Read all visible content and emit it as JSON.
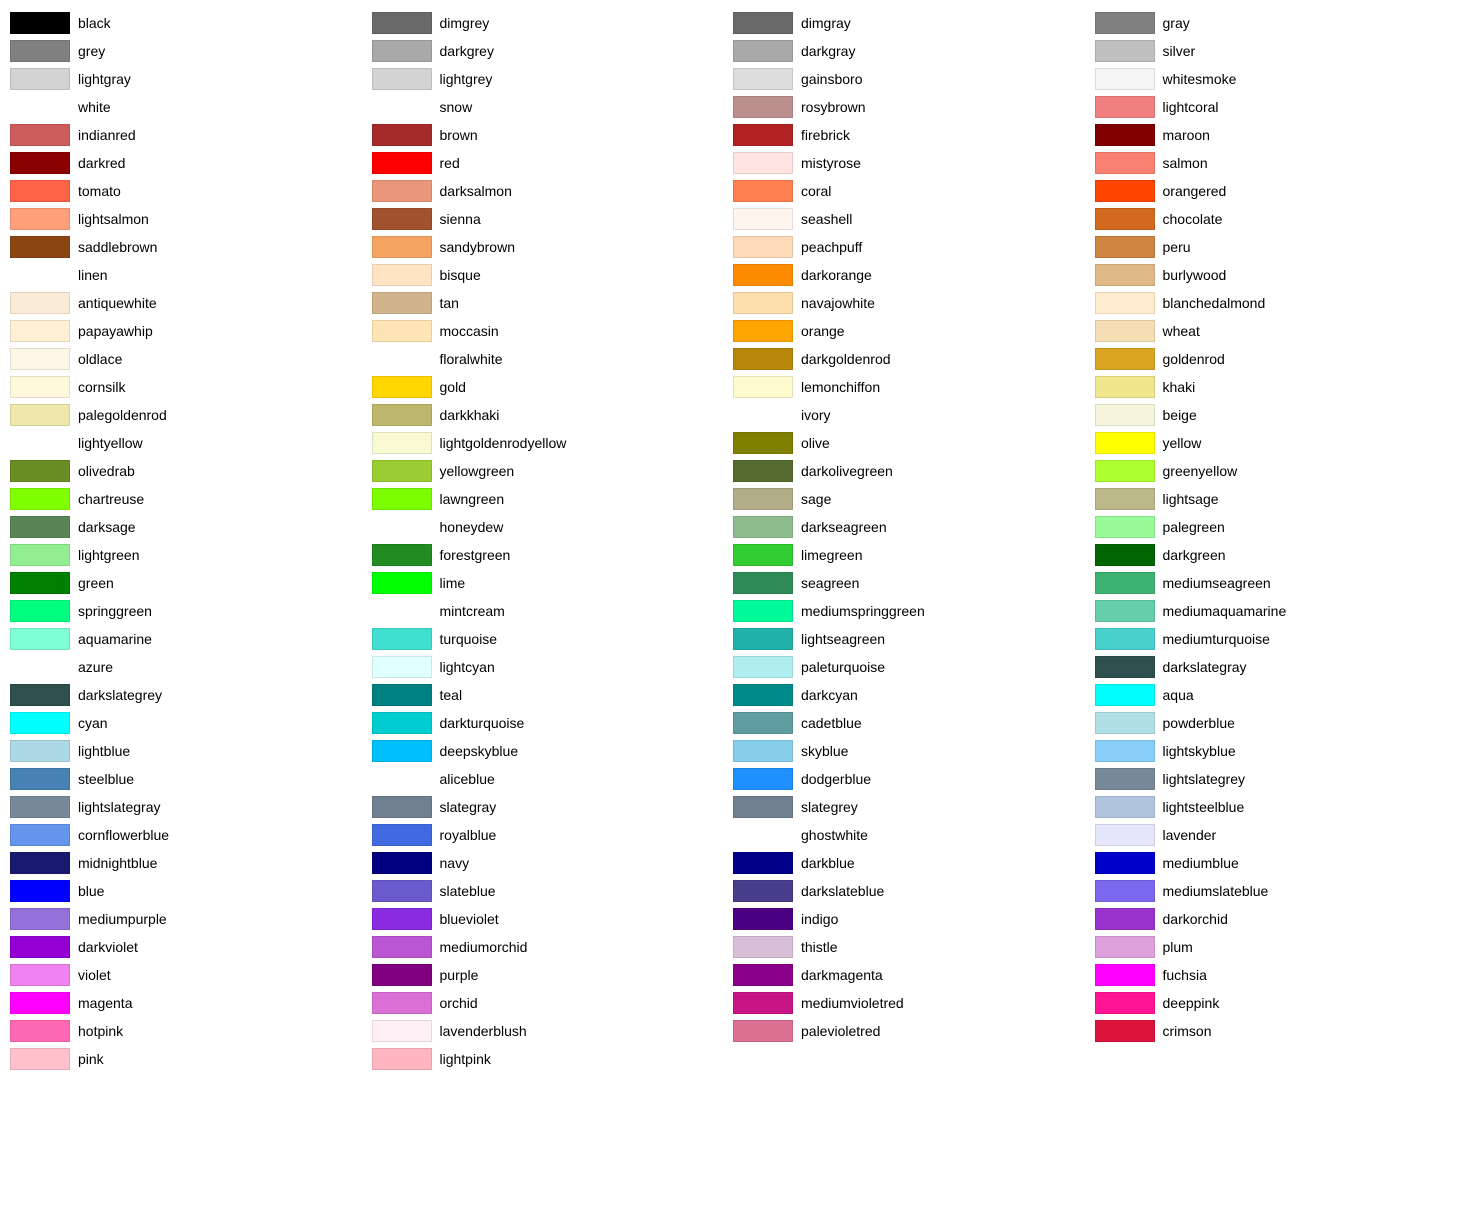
{
  "columns": [
    [
      {
        "name": "black",
        "color": "#000000"
      },
      {
        "name": "grey",
        "color": "#808080"
      },
      {
        "name": "lightgray",
        "color": "#d3d3d3"
      },
      {
        "name": "white",
        "color": null
      },
      {
        "name": "indianred",
        "color": "#cd5c5c"
      },
      {
        "name": "darkred",
        "color": "#8b0000"
      },
      {
        "name": "tomato",
        "color": "#ff6347"
      },
      {
        "name": "lightsalmon",
        "color": "#ffa07a"
      },
      {
        "name": "saddlebrown",
        "color": "#8b4513"
      },
      {
        "name": "linen",
        "color": null
      },
      {
        "name": "antiquewhite",
        "color": "#faebd7"
      },
      {
        "name": "papayawhip",
        "color": "#ffefd5"
      },
      {
        "name": "oldlace",
        "color": "#fdf5e6"
      },
      {
        "name": "cornsilk",
        "color": "#fff8dc"
      },
      {
        "name": "palegoldenrod",
        "color": "#eee8aa"
      },
      {
        "name": "lightyellow",
        "color": null
      },
      {
        "name": "olivedrab",
        "color": "#6b8e23"
      },
      {
        "name": "chartreuse",
        "color": "#7fff00"
      },
      {
        "name": "darksage",
        "color": "#598556"
      },
      {
        "name": "lightgreen",
        "color": "#90ee90"
      },
      {
        "name": "green",
        "color": "#008000"
      },
      {
        "name": "springgreen",
        "color": "#00ff7f"
      },
      {
        "name": "aquamarine",
        "color": "#7fffd4"
      },
      {
        "name": "azure",
        "color": null
      },
      {
        "name": "darkslategrey",
        "color": "#2f4f4f"
      },
      {
        "name": "cyan",
        "color": "#00ffff"
      },
      {
        "name": "lightblue",
        "color": "#add8e6"
      },
      {
        "name": "steelblue",
        "color": "#4682b4"
      },
      {
        "name": "lightslategray",
        "color": "#778899"
      },
      {
        "name": "cornflowerblue",
        "color": "#6495ed"
      },
      {
        "name": "midnightblue",
        "color": "#191970"
      },
      {
        "name": "blue",
        "color": "#0000ff"
      },
      {
        "name": "mediumpurple",
        "color": "#9370db"
      },
      {
        "name": "darkviolet",
        "color": "#9400d3"
      },
      {
        "name": "violet",
        "color": "#ee82ee"
      },
      {
        "name": "magenta",
        "color": "#ff00ff"
      },
      {
        "name": "hotpink",
        "color": "#ff69b4"
      },
      {
        "name": "pink",
        "color": "#ffc0cb"
      }
    ],
    [
      {
        "name": "dimgrey",
        "color": "#696969"
      },
      {
        "name": "darkgrey",
        "color": "#a9a9a9"
      },
      {
        "name": "lightgrey",
        "color": "#d3d3d3"
      },
      {
        "name": "snow",
        "color": null
      },
      {
        "name": "brown",
        "color": "#a52a2a"
      },
      {
        "name": "red",
        "color": "#ff0000"
      },
      {
        "name": "darksalmon",
        "color": "#e9967a"
      },
      {
        "name": "sienna",
        "color": "#a0522d"
      },
      {
        "name": "sandybrown",
        "color": "#f4a460"
      },
      {
        "name": "bisque",
        "color": "#ffe4c4"
      },
      {
        "name": "tan",
        "color": "#d2b48c"
      },
      {
        "name": "moccasin",
        "color": "#ffe4b5"
      },
      {
        "name": "floralwhite",
        "color": null
      },
      {
        "name": "gold",
        "color": "#ffd700"
      },
      {
        "name": "darkkhaki",
        "color": "#bdb76b"
      },
      {
        "name": "lightgoldenrodyellow",
        "color": "#fafad2"
      },
      {
        "name": "yellowgreen",
        "color": "#9acd32"
      },
      {
        "name": "lawngreen",
        "color": "#7cfc00"
      },
      {
        "name": "honeydew",
        "color": null
      },
      {
        "name": "forestgreen",
        "color": "#228b22"
      },
      {
        "name": "lime",
        "color": "#00ff00"
      },
      {
        "name": "mintcream",
        "color": null
      },
      {
        "name": "turquoise",
        "color": "#40e0d0"
      },
      {
        "name": "lightcyan",
        "color": "#e0ffff"
      },
      {
        "name": "teal",
        "color": "#008080"
      },
      {
        "name": "darkturquoise",
        "color": "#00ced1"
      },
      {
        "name": "deepskyblue",
        "color": "#00bfff"
      },
      {
        "name": "aliceblue",
        "color": null
      },
      {
        "name": "slategray",
        "color": "#708090"
      },
      {
        "name": "royalblue",
        "color": "#4169e1"
      },
      {
        "name": "navy",
        "color": "#000080"
      },
      {
        "name": "slateblue",
        "color": "#6a5acd"
      },
      {
        "name": "blueviolet",
        "color": "#8a2be2"
      },
      {
        "name": "mediumorchid",
        "color": "#ba55d3"
      },
      {
        "name": "purple",
        "color": "#800080"
      },
      {
        "name": "orchid",
        "color": "#da70d6"
      },
      {
        "name": "lavenderblush",
        "color": "#fff0f5"
      },
      {
        "name": "lightpink",
        "color": "#ffb6c1"
      }
    ],
    [
      {
        "name": "dimgray",
        "color": "#696969"
      },
      {
        "name": "darkgray",
        "color": "#a9a9a9"
      },
      {
        "name": "gainsboro",
        "color": "#dcdcdc"
      },
      {
        "name": "rosybrown",
        "color": "#bc8f8f"
      },
      {
        "name": "firebrick",
        "color": "#b22222"
      },
      {
        "name": "mistyrose",
        "color": "#ffe4e1"
      },
      {
        "name": "coral",
        "color": "#ff7f50"
      },
      {
        "name": "seashell",
        "color": "#fff5ee"
      },
      {
        "name": "peachpuff",
        "color": "#ffdab9"
      },
      {
        "name": "darkorange",
        "color": "#ff8c00"
      },
      {
        "name": "navajowhite",
        "color": "#ffdead"
      },
      {
        "name": "orange",
        "color": "#ffa500"
      },
      {
        "name": "darkgoldenrod",
        "color": "#b8860b"
      },
      {
        "name": "lemonchiffon",
        "color": "#fffacd"
      },
      {
        "name": "ivory",
        "color": null
      },
      {
        "name": "olive",
        "color": "#808000"
      },
      {
        "name": "darkolivegreen",
        "color": "#556b2f"
      },
      {
        "name": "sage",
        "color": "#b2ac88"
      },
      {
        "name": "darkseagreen",
        "color": "#8fbc8f"
      },
      {
        "name": "limegreen",
        "color": "#32cd32"
      },
      {
        "name": "seagreen",
        "color": "#2e8b57"
      },
      {
        "name": "mediumspringgreen",
        "color": "#00fa9a"
      },
      {
        "name": "lightseagreen",
        "color": "#20b2aa"
      },
      {
        "name": "paleturquoise",
        "color": "#afeeee"
      },
      {
        "name": "darkcyan",
        "color": "#008b8b"
      },
      {
        "name": "cadetblue",
        "color": "#5f9ea0"
      },
      {
        "name": "skyblue",
        "color": "#87ceeb"
      },
      {
        "name": "dodgerblue",
        "color": "#1e90ff"
      },
      {
        "name": "slategrey",
        "color": "#708090"
      },
      {
        "name": "ghostwhite",
        "color": null
      },
      {
        "name": "darkblue",
        "color": "#00008b"
      },
      {
        "name": "darkslateblue",
        "color": "#483d8b"
      },
      {
        "name": "indigo",
        "color": "#4b0082"
      },
      {
        "name": "thistle",
        "color": "#d8bfd8"
      },
      {
        "name": "darkmagenta",
        "color": "#8b008b"
      },
      {
        "name": "mediumvioletred",
        "color": "#c71585"
      },
      {
        "name": "palevioletred",
        "color": "#db7093"
      }
    ],
    [
      {
        "name": "gray",
        "color": "#808080"
      },
      {
        "name": "silver",
        "color": "#c0c0c0"
      },
      {
        "name": "whitesmoke",
        "color": "#f5f5f5"
      },
      {
        "name": "lightcoral",
        "color": "#f08080"
      },
      {
        "name": "maroon",
        "color": "#800000"
      },
      {
        "name": "salmon",
        "color": "#fa8072"
      },
      {
        "name": "orangered",
        "color": "#ff4500"
      },
      {
        "name": "chocolate",
        "color": "#d2691e"
      },
      {
        "name": "peru",
        "color": "#cd853f"
      },
      {
        "name": "burlywood",
        "color": "#deb887"
      },
      {
        "name": "blanchedalmond",
        "color": "#ffebcd"
      },
      {
        "name": "wheat",
        "color": "#f5deb3"
      },
      {
        "name": "goldenrod",
        "color": "#daa520"
      },
      {
        "name": "khaki",
        "color": "#f0e68c"
      },
      {
        "name": "beige",
        "color": "#f5f5dc"
      },
      {
        "name": "yellow",
        "color": "#ffff00"
      },
      {
        "name": "greenyellow",
        "color": "#adff2f"
      },
      {
        "name": "lightsage",
        "color": "#bcb88a"
      },
      {
        "name": "palegreen",
        "color": "#98fb98"
      },
      {
        "name": "darkgreen",
        "color": "#006400"
      },
      {
        "name": "mediumseagreen",
        "color": "#3cb371"
      },
      {
        "name": "mediumaquamarine",
        "color": "#66cdaa"
      },
      {
        "name": "mediumturquoise",
        "color": "#48d1cc"
      },
      {
        "name": "darkslategray",
        "color": "#2f4f4f"
      },
      {
        "name": "aqua",
        "color": "#00ffff"
      },
      {
        "name": "powderblue",
        "color": "#b0e0e6"
      },
      {
        "name": "lightskyblue",
        "color": "#87cefa"
      },
      {
        "name": "lightslategrey",
        "color": "#778899"
      },
      {
        "name": "lightsteelblue",
        "color": "#b0c4de"
      },
      {
        "name": "lavender",
        "color": "#e6e6fa"
      },
      {
        "name": "mediumblue",
        "color": "#0000cd"
      },
      {
        "name": "mediumslateblue",
        "color": "#7b68ee"
      },
      {
        "name": "darkorchid",
        "color": "#9932cc"
      },
      {
        "name": "plum",
        "color": "#dda0dd"
      },
      {
        "name": "fuchsia",
        "color": "#ff00ff"
      },
      {
        "name": "deeppink",
        "color": "#ff1493"
      },
      {
        "name": "crimson",
        "color": "#dc143c"
      }
    ]
  ]
}
